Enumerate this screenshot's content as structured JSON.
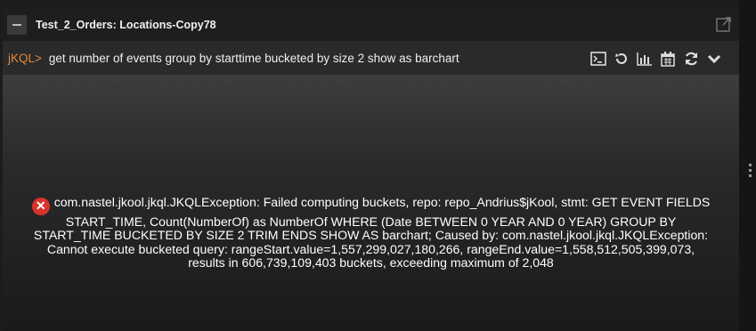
{
  "window": {
    "title": "Test_2_Orders: Locations-Copy78"
  },
  "query": {
    "prompt": "jKQL>",
    "text": "get number of events group by starttime bucketed by size 2 show as barchart"
  },
  "toolbar": {
    "icons": [
      "console-icon",
      "history-icon",
      "chart-icon",
      "calendar-icon",
      "refresh-icon",
      "chevron-down-icon"
    ]
  },
  "error": {
    "message": "com.nastel.jkool.jkql.JKQLException: Failed computing buckets, repo: repo_Andrius$jKool, stmt: GET EVENT FIELDS START_TIME, Count(NumberOf) as NumberOf WHERE (Date BETWEEN 0 YEAR AND 0 YEAR) GROUP BY START_TIME BUCKETED BY SIZE 2 TRIM ENDS SHOW AS barchart; Caused by: com.nastel.jkool.jkql.JKQLException: Cannot execute bucketed query: rangeStart.value=1,557,299,027,180,266, rangeEnd.value=1,558,512,505,399,073, results in 606,739,109,403 buckets, exceeding maximum of 2,048",
    "color": "#d9332b"
  },
  "colors": {
    "prompt": "#e8883a",
    "background": "#1c1c1c"
  }
}
